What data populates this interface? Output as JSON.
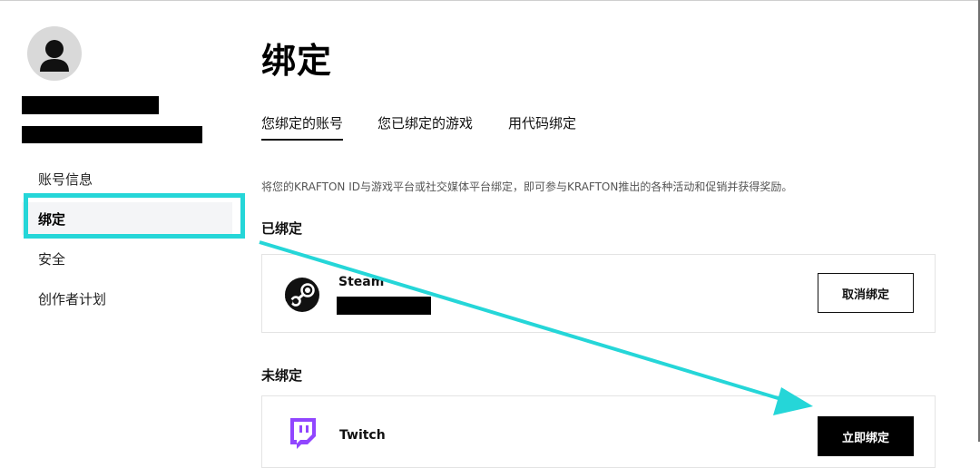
{
  "sidebar": {
    "items": [
      {
        "label": "账号信息"
      },
      {
        "label": "绑定"
      },
      {
        "label": "安全"
      },
      {
        "label": "创作者计划"
      }
    ]
  },
  "page": {
    "title": "绑定",
    "tabs": [
      {
        "label": "您绑定的账号"
      },
      {
        "label": "您已绑定的游戏"
      },
      {
        "label": "用代码绑定"
      }
    ],
    "description": "将您的KRAFTON ID与游戏平台或社交媒体平台绑定，即可参与KRAFTON推出的各种活动和促销并获得奖励。"
  },
  "linked": {
    "section_title": "已绑定",
    "accounts": [
      {
        "platform": "Steam",
        "icon": "steam-icon",
        "button_label": "取消绑定"
      }
    ]
  },
  "unlinked": {
    "section_title": "未绑定",
    "accounts": [
      {
        "platform": "Twitch",
        "icon": "twitch-icon",
        "icon_color": "#9146ff",
        "button_label": "立即绑定"
      }
    ]
  },
  "annotation": {
    "color": "#25d6d8"
  }
}
